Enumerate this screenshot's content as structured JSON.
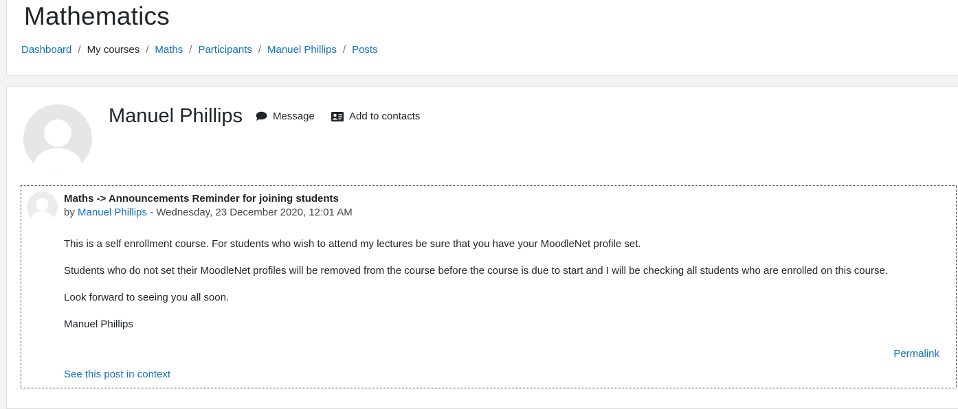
{
  "header": {
    "title": "Mathematics",
    "breadcrumb": [
      {
        "label": "Dashboard",
        "link": true
      },
      {
        "label": "My courses",
        "link": false
      },
      {
        "label": "Maths",
        "link": true
      },
      {
        "label": "Participants",
        "link": true
      },
      {
        "label": "Manuel Phillips",
        "link": true
      },
      {
        "label": "Posts",
        "link": true
      }
    ],
    "separator": "/"
  },
  "profile": {
    "name": "Manuel Phillips",
    "message_label": "Message",
    "add_contacts_label": "Add to contacts",
    "message_icon": "speech-bubble-icon",
    "contacts_icon": "address-card-icon"
  },
  "post": {
    "subject": "Maths -> Announcements Reminder for joining students",
    "by_prefix": "by",
    "author": "Manuel Phillips",
    "date": " - Wednesday, 23 December 2020, 12:01 AM",
    "paragraphs": [
      "This is a self enrollment course. For students who wish to attend my lectures be sure that you have your MoodleNet profile set.",
      "Students who do not set their MoodleNet profiles will be  removed from the course before the course is due to start and I will be checking all students who are enrolled on this course.",
      "Look forward to seeing you all soon.",
      "Manuel Phillips"
    ],
    "permalink_label": "Permalink",
    "context_label": "See this post in context"
  },
  "colors": {
    "link": "#0f6fc5",
    "text": "#212529",
    "avatar_bg": "#e6e6e6"
  }
}
